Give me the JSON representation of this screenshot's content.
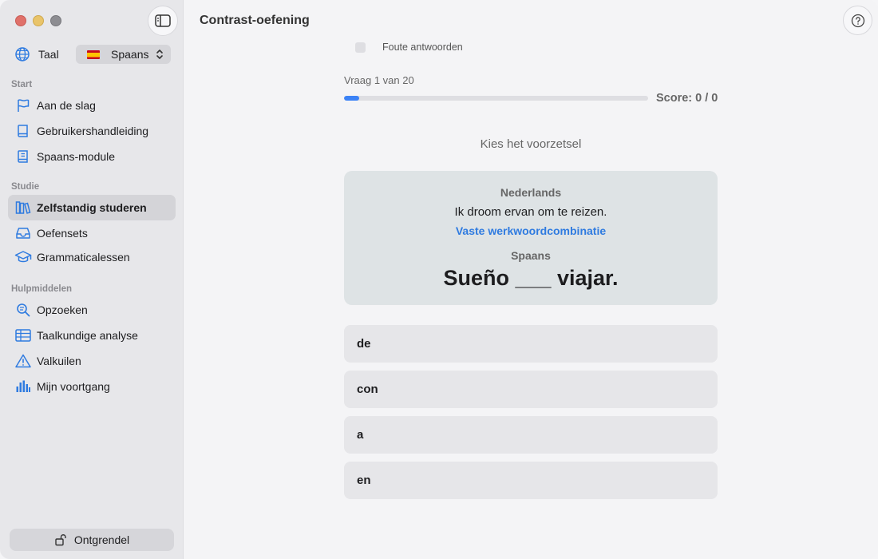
{
  "window": {
    "title": "Contrast-oefening"
  },
  "sidebar": {
    "language_label": "Taal",
    "language_value": "Spaans",
    "sections": {
      "start": "Start",
      "study": "Studie",
      "tools": "Hulpmiddelen"
    },
    "items": {
      "aan_de_slag": "Aan de slag",
      "handleiding": "Gebruikershandleiding",
      "module": "Spaans-module",
      "zelfstandig": "Zelfstandig studeren",
      "oefensets": "Oefensets",
      "grammatica": "Grammaticalessen",
      "opzoeken": "Opzoeken",
      "analyse": "Taalkundige analyse",
      "valkuilen": "Valkuilen",
      "voortgang": "Mijn voortgang"
    },
    "unlock_label": "Ontgrendel"
  },
  "main": {
    "wrong_answers_label": "Foute antwoorden",
    "progress_label": "Vraag 1 van 20",
    "progress_fraction": 0.05,
    "score": "Score: 0 / 0",
    "prompt": "Kies het voorzetsel",
    "card": {
      "source_language": "Nederlands",
      "source_sentence": "Ik droom ervan om te reizen.",
      "hint": "Vaste werkwoordcombinatie",
      "target_language": "Spaans",
      "target_sentence": "Sueño ___ viajar."
    },
    "options": [
      "de",
      "con",
      "a",
      "en"
    ]
  },
  "colors": {
    "accent": "#3b82f6",
    "hint": "#2f7be0"
  }
}
